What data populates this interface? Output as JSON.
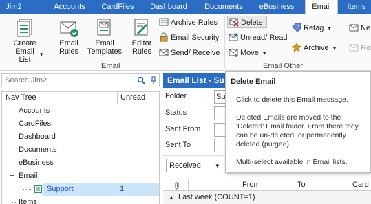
{
  "tabs": [
    {
      "label": "Jim2",
      "active": false
    },
    {
      "label": "Accounts",
      "active": false
    },
    {
      "label": "CardFiles",
      "active": false
    },
    {
      "label": "Dashboard",
      "active": false
    },
    {
      "label": "Documents",
      "active": false
    },
    {
      "label": "eBusiness",
      "active": false
    },
    {
      "label": "Email",
      "active": true
    },
    {
      "label": "Items",
      "active": false
    }
  ],
  "ribbon": {
    "create_email_list": "Create Email List",
    "dropdown_marker": "▾",
    "email_rules": "Email Rules",
    "email_templates": "Email Templates",
    "editor_rules": "Editor Rules",
    "group_email": "Email",
    "archive_rules": "Archive Rules",
    "email_security": "Email Security",
    "send_receive": "Send/ Receive",
    "delete": "Delete",
    "unread_read": "Unread/ Read",
    "move": "Move",
    "retag": "Retag",
    "archive": "Archive",
    "group_email_other": "Email Other",
    "new_partial": "Ne",
    "rel_partial": "Rel"
  },
  "search": {
    "placeholder": "Search Jim2",
    "icon": "search-icon",
    "pin_icon": "pin-icon"
  },
  "navtree": {
    "header_name": "Nav Tree",
    "header_unread": "Unread",
    "items": [
      {
        "label": "Accounts"
      },
      {
        "label": "CardFiles"
      },
      {
        "label": "Dashboard"
      },
      {
        "label": "Documents"
      },
      {
        "label": "eBusiness"
      },
      {
        "label": "Email",
        "expander": "−"
      },
      {
        "label": "Support",
        "count": "1",
        "selected": true
      },
      {
        "label": "Items"
      }
    ]
  },
  "email_list": {
    "title": "Email List - Su",
    "fields": [
      {
        "label": "Folder",
        "value": "Sup"
      },
      {
        "label": "Status",
        "value": ""
      },
      {
        "label": "Sent From",
        "value": ""
      },
      {
        "label": "Sent To",
        "value": ""
      }
    ],
    "sort_dropdown": "Received",
    "columns": {
      "attach_icon": "paperclip-icon",
      "from": "From",
      "to": "To",
      "card": "Card"
    },
    "group_row": "Last week (COUNT=1)",
    "group_expander": "▲"
  },
  "tooltip": {
    "title": "Delete Email",
    "line1": "Click to delete this Email message.",
    "line2": "Deleted Emails are moved to the 'Deleted' Email folder. From there they can be un-deleted, or permanently deleted (purged).",
    "line3": "Multi-select available in Email lists."
  },
  "colors": {
    "accent": "#2b6cc4",
    "selected_row": "#cce4f7",
    "link_blue": "#1a4fb5"
  }
}
